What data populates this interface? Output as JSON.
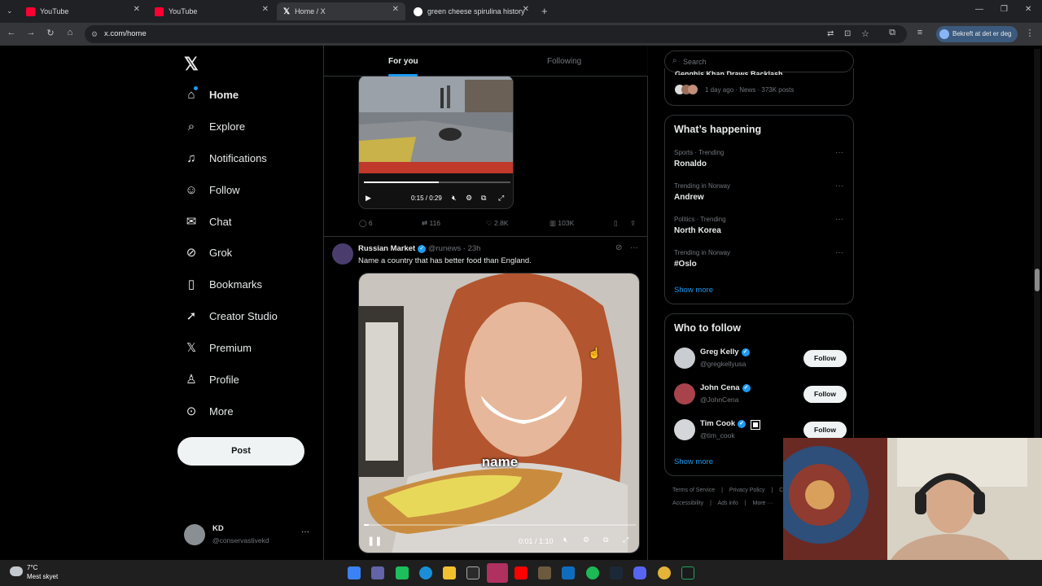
{
  "browser": {
    "tabs": [
      {
        "title": "YouTube",
        "active": false
      },
      {
        "title": "YouTube",
        "active": false
      },
      {
        "title": "Home / X",
        "active": true
      },
      {
        "title": "green cheese spirulina history",
        "active": false
      }
    ],
    "url": "x.com/home",
    "profile_label": "Bekreft at det er deg"
  },
  "sidebar": {
    "items": [
      {
        "label": "Home",
        "icon": "home-icon"
      },
      {
        "label": "Explore",
        "icon": "search-icon"
      },
      {
        "label": "Notifications",
        "icon": "bell-icon"
      },
      {
        "label": "Follow",
        "icon": "person-add-icon"
      },
      {
        "label": "Chat",
        "icon": "mail-icon"
      },
      {
        "label": "Grok",
        "icon": "grok-icon"
      },
      {
        "label": "Bookmarks",
        "icon": "bookmark-icon"
      },
      {
        "label": "Creator Studio",
        "icon": "rocket-icon"
      },
      {
        "label": "Premium",
        "icon": "x-logo-icon"
      },
      {
        "label": "Profile",
        "icon": "person-icon"
      },
      {
        "label": "More",
        "icon": "more-circle-icon"
      }
    ],
    "post_label": "Post",
    "account": {
      "name": "KD",
      "handle": "@conservastivekd"
    }
  },
  "feed": {
    "tabs": {
      "for_you": "For you",
      "following": "Following"
    },
    "video1": {
      "time": "0:15 / 0:29"
    },
    "post1_actions": {
      "replies": "6",
      "reposts": "116",
      "likes": "2.8K",
      "views": "103K"
    },
    "post2": {
      "author": "Russian Market",
      "handle": "@runews",
      "time": "23h",
      "text": "Name a country that has better food than England.",
      "caption": "name",
      "video_time": "0:01 / 1:10"
    }
  },
  "right": {
    "search_placeholder": "Search",
    "top_trend": {
      "title": "Genghis Khan Draws Backlash",
      "meta": "1 day ago · News · 373K posts"
    },
    "whats_happening": {
      "title": "What’s happening",
      "trends": [
        {
          "meta": "Sports · Trending",
          "name": "Ronaldo"
        },
        {
          "meta": "Trending in Norway",
          "name": "Andrew"
        },
        {
          "meta": "Politics · Trending",
          "name": "North Korea"
        },
        {
          "meta": "Trending in Norway",
          "name": "#Oslo"
        }
      ],
      "show_more": "Show more"
    },
    "who_to_follow": {
      "title": "Who to follow",
      "users": [
        {
          "name": "Greg Kelly",
          "handle": "@gregkellyusa",
          "button": "Follow"
        },
        {
          "name": "John Cena",
          "handle": "@JohnCena",
          "button": "Follow"
        },
        {
          "name": "Tim Cook",
          "handle": "@tim_cook",
          "button": "Follow"
        }
      ],
      "show_more": "Show more"
    },
    "footer": {
      "links": [
        "Terms of Service",
        "Privacy Policy",
        "Co",
        "Accessibility",
        "Ads info",
        "More ···"
      ]
    }
  },
  "taskbar": {
    "weather_temp": "7°C",
    "weather_desc": "Mest skyet"
  },
  "colors": {
    "accent": "#1d9bf0",
    "background": "#000000",
    "border": "#2f3336",
    "muted": "#71767b"
  }
}
